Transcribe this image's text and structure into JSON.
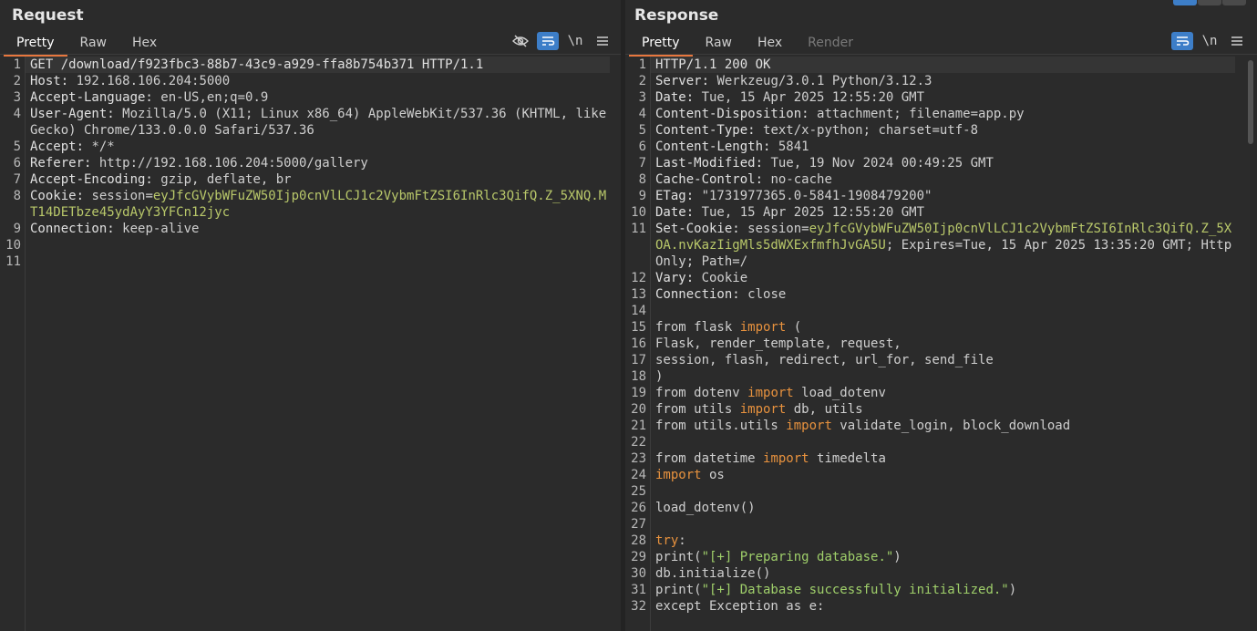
{
  "request": {
    "title": "Request",
    "tabs": [
      "Pretty",
      "Raw",
      "Hex"
    ],
    "tools": [
      "eye-off-icon",
      "wrap-icon",
      "\\n",
      "menu-icon"
    ],
    "lines": [
      {
        "n": "1",
        "parts": [
          {
            "t": "GET /download/f923fbc3-88b7-43c9-a929-ffa8b754b371 HTTP/1.1",
            "c": "hk"
          }
        ]
      },
      {
        "n": "2",
        "parts": [
          {
            "t": "Host: ",
            "c": "hk"
          },
          {
            "t": "192.168.106.204:5000",
            "c": "hv"
          }
        ]
      },
      {
        "n": "3",
        "parts": [
          {
            "t": "Accept-Language: ",
            "c": "hk"
          },
          {
            "t": "en-US,en;q=0.9",
            "c": "hv"
          }
        ]
      },
      {
        "n": "4",
        "parts": [
          {
            "t": "User-Agent: ",
            "c": "hk"
          },
          {
            "t": "Mozilla/5.0 (X11; Linux x86_64) AppleWebKit/537.36 (KHTML, like Gecko) Chrome/133.0.0.0 Safari/537.36",
            "c": "hv"
          }
        ]
      },
      {
        "n": "5",
        "parts": [
          {
            "t": "Accept: ",
            "c": "hk"
          },
          {
            "t": "*/*",
            "c": "hv"
          }
        ]
      },
      {
        "n": "6",
        "parts": [
          {
            "t": "Referer: ",
            "c": "hk"
          },
          {
            "t": "http://192.168.106.204:5000/gallery",
            "c": "hv"
          }
        ]
      },
      {
        "n": "7",
        "parts": [
          {
            "t": "Accept-Encoding: ",
            "c": "hk"
          },
          {
            "t": "gzip, deflate, br",
            "c": "hv"
          }
        ]
      },
      {
        "n": "8",
        "parts": [
          {
            "t": "Cookie: ",
            "c": "hk"
          },
          {
            "t": "session=",
            "c": "hv"
          },
          {
            "t": "eyJfcGVybWFuZW50Ijp0cnVlLCJ1c2VybmFtZSI6InRlc3QifQ.Z_5XNQ.MT14DETbze45ydAyY3YFCn12jyc",
            "c": "ck"
          }
        ]
      },
      {
        "n": "9",
        "parts": [
          {
            "t": "Connection: ",
            "c": "hk"
          },
          {
            "t": "keep-alive",
            "c": "hv"
          }
        ]
      },
      {
        "n": "10",
        "parts": [
          {
            "t": "",
            "c": "hv"
          }
        ]
      },
      {
        "n": "11",
        "parts": [
          {
            "t": "",
            "c": "hv"
          }
        ]
      }
    ]
  },
  "response": {
    "title": "Response",
    "tabs": [
      "Pretty",
      "Raw",
      "Hex",
      "Render"
    ],
    "tools": [
      "wrap-icon",
      "\\n",
      "menu-icon"
    ],
    "lines": [
      {
        "n": "1",
        "parts": [
          {
            "t": "HTTP/1.1 200 OK",
            "c": "hk"
          }
        ]
      },
      {
        "n": "2",
        "parts": [
          {
            "t": "Server: ",
            "c": "hk"
          },
          {
            "t": "Werkzeug/3.0.1 Python/3.12.3",
            "c": "hv"
          }
        ]
      },
      {
        "n": "3",
        "parts": [
          {
            "t": "Date: ",
            "c": "hk"
          },
          {
            "t": "Tue, 15 Apr 2025 12:55:20 GMT",
            "c": "hv"
          }
        ]
      },
      {
        "n": "4",
        "parts": [
          {
            "t": "Content-Disposition: ",
            "c": "hk"
          },
          {
            "t": "attachment; filename=app.py",
            "c": "hv"
          }
        ]
      },
      {
        "n": "5",
        "parts": [
          {
            "t": "Content-Type: ",
            "c": "hk"
          },
          {
            "t": "text/x-python; charset=utf-8",
            "c": "hv"
          }
        ]
      },
      {
        "n": "6",
        "parts": [
          {
            "t": "Content-Length: ",
            "c": "hk"
          },
          {
            "t": "5841",
            "c": "hv"
          }
        ]
      },
      {
        "n": "7",
        "parts": [
          {
            "t": "Last-Modified: ",
            "c": "hk"
          },
          {
            "t": "Tue, 19 Nov 2024 00:49:25 GMT",
            "c": "hv"
          }
        ]
      },
      {
        "n": "8",
        "parts": [
          {
            "t": "Cache-Control: ",
            "c": "hk"
          },
          {
            "t": "no-cache",
            "c": "hv"
          }
        ]
      },
      {
        "n": "9",
        "parts": [
          {
            "t": "ETag: ",
            "c": "hk"
          },
          {
            "t": "\"1731977365.0-5841-1908479200\"",
            "c": "hv"
          }
        ]
      },
      {
        "n": "10",
        "parts": [
          {
            "t": "Date: ",
            "c": "hk"
          },
          {
            "t": "Tue, 15 Apr 2025 12:55:20 GMT",
            "c": "hv"
          }
        ]
      },
      {
        "n": "11",
        "parts": [
          {
            "t": "Set-Cookie: ",
            "c": "hk"
          },
          {
            "t": "session=",
            "c": "hv"
          },
          {
            "t": "eyJfcGVybWFuZW50Ijp0cnVlLCJ1c2VybmFtZSI6InRlc3QifQ.Z_5XOA.nvKazIigMls5dWXExfmfhJvGA5U",
            "c": "ck"
          },
          {
            "t": "; Expires=Tue, 15 Apr 2025 13:35:20 GMT; HttpOnly; Path=/",
            "c": "hv"
          }
        ]
      },
      {
        "n": "12",
        "parts": [
          {
            "t": "Vary: ",
            "c": "hk"
          },
          {
            "t": "Cookie",
            "c": "hv"
          }
        ]
      },
      {
        "n": "13",
        "parts": [
          {
            "t": "Connection: ",
            "c": "hk"
          },
          {
            "t": "close",
            "c": "hv"
          }
        ]
      },
      {
        "n": "14",
        "parts": [
          {
            "t": "",
            "c": "hv"
          }
        ]
      },
      {
        "n": "15",
        "parts": [
          {
            "t": "from flask ",
            "c": "hv"
          },
          {
            "t": "import",
            "c": "kw"
          },
          {
            "t": " (",
            "c": "hv"
          }
        ]
      },
      {
        "n": "16",
        "parts": [
          {
            "t": "Flask, render_template, request,",
            "c": "hv"
          }
        ]
      },
      {
        "n": "17",
        "parts": [
          {
            "t": "session, flash, redirect, url_for, send_file",
            "c": "hv"
          }
        ]
      },
      {
        "n": "18",
        "parts": [
          {
            "t": ")",
            "c": "hv"
          }
        ]
      },
      {
        "n": "19",
        "parts": [
          {
            "t": "from dotenv ",
            "c": "hv"
          },
          {
            "t": "import",
            "c": "kw"
          },
          {
            "t": " load_dotenv",
            "c": "hv"
          }
        ]
      },
      {
        "n": "20",
        "parts": [
          {
            "t": "from utils ",
            "c": "hv"
          },
          {
            "t": "import",
            "c": "kw"
          },
          {
            "t": " db, utils",
            "c": "hv"
          }
        ]
      },
      {
        "n": "21",
        "parts": [
          {
            "t": "from utils.utils ",
            "c": "hv"
          },
          {
            "t": "import",
            "c": "kw"
          },
          {
            "t": " validate_login, block_download",
            "c": "hv"
          }
        ]
      },
      {
        "n": "22",
        "parts": [
          {
            "t": "",
            "c": "hv"
          }
        ]
      },
      {
        "n": "23",
        "parts": [
          {
            "t": "from datetime ",
            "c": "hv"
          },
          {
            "t": "import",
            "c": "kw"
          },
          {
            "t": " timedelta",
            "c": "hv"
          }
        ]
      },
      {
        "n": "24",
        "parts": [
          {
            "t": "import",
            "c": "kw"
          },
          {
            "t": " os",
            "c": "hv"
          }
        ]
      },
      {
        "n": "25",
        "parts": [
          {
            "t": "",
            "c": "hv"
          }
        ]
      },
      {
        "n": "26",
        "parts": [
          {
            "t": "load_dotenv()",
            "c": "hv"
          }
        ]
      },
      {
        "n": "27",
        "parts": [
          {
            "t": "",
            "c": "hv"
          }
        ]
      },
      {
        "n": "28",
        "parts": [
          {
            "t": "try",
            "c": "kw"
          },
          {
            "t": ":",
            "c": "hv"
          }
        ]
      },
      {
        "n": "29",
        "parts": [
          {
            "t": "print(",
            "c": "hv"
          },
          {
            "t": "\"[+] Preparing database.\"",
            "c": "str"
          },
          {
            "t": ")",
            "c": "hv"
          }
        ]
      },
      {
        "n": "30",
        "parts": [
          {
            "t": "db.initialize()",
            "c": "hv"
          }
        ]
      },
      {
        "n": "31",
        "parts": [
          {
            "t": "print(",
            "c": "hv"
          },
          {
            "t": "\"[+] Database successfully initialized.\"",
            "c": "str"
          },
          {
            "t": ")",
            "c": "hv"
          }
        ]
      },
      {
        "n": "32",
        "parts": [
          {
            "t": "except Exception as e:",
            "c": "hv"
          }
        ]
      }
    ]
  }
}
